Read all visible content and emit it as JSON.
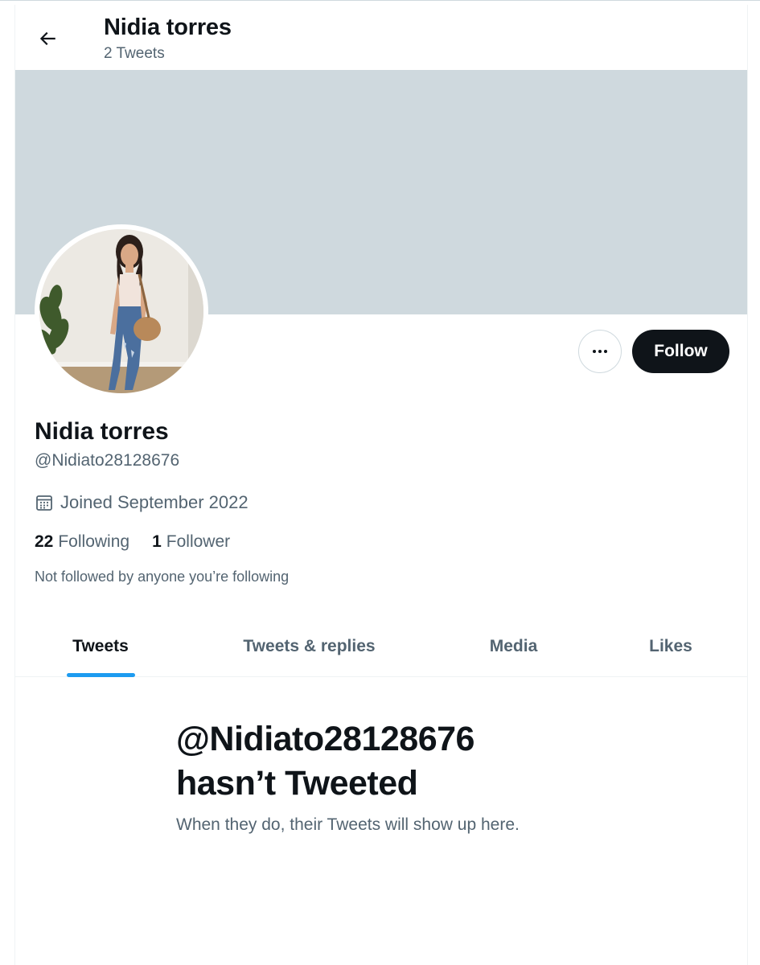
{
  "header": {
    "title": "Nidia torres",
    "tweet_count": "2 Tweets",
    "back_icon": "arrow-left-icon"
  },
  "profile": {
    "display_name": "Nidia torres",
    "handle": "@Nidiato28128676",
    "joined": "Joined September 2022",
    "following_count": "22",
    "following_label": "Following",
    "followers_count": "1",
    "followers_label": "Follower",
    "not_followed": "Not followed by anyone you’re following"
  },
  "actions": {
    "more_icon": "more-horizontal-icon",
    "follow_label": "Follow"
  },
  "tabs": [
    {
      "label": "Tweets",
      "active": true
    },
    {
      "label": "Tweets & replies",
      "active": false
    },
    {
      "label": "Media",
      "active": false
    },
    {
      "label": "Likes",
      "active": false
    }
  ],
  "empty_state": {
    "title_line1": "@Nidiato28128676",
    "title_line2": "hasn’t Tweeted",
    "subtitle": "When they do, their Tweets will show up here."
  },
  "colors": {
    "banner": "#cfd9de",
    "accent": "#1d9bf0",
    "text_primary": "#0f1419",
    "text_secondary": "#536471"
  }
}
